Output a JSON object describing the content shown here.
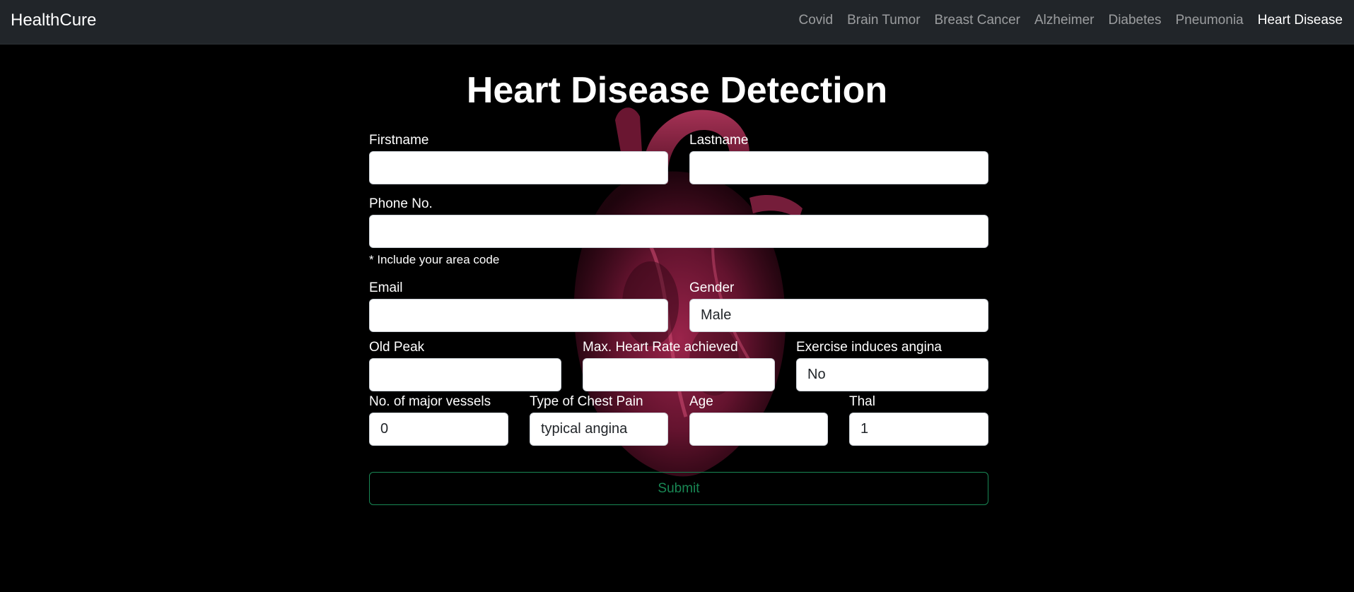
{
  "navbar": {
    "brand": "HealthCure",
    "links": [
      {
        "label": "Covid"
      },
      {
        "label": "Brain Tumor"
      },
      {
        "label": "Breast Cancer"
      },
      {
        "label": "Alzheimer"
      },
      {
        "label": "Diabetes"
      },
      {
        "label": "Pneumonia"
      },
      {
        "label": "Heart Disease",
        "active": true
      }
    ]
  },
  "page": {
    "title": "Heart Disease Detection"
  },
  "form": {
    "firstname": {
      "label": "Firstname",
      "value": ""
    },
    "lastname": {
      "label": "Lastname",
      "value": ""
    },
    "phone": {
      "label": "Phone No.",
      "value": "",
      "help": "* Include your area code"
    },
    "email": {
      "label": "Email",
      "value": ""
    },
    "gender": {
      "label": "Gender",
      "value": "Male"
    },
    "old_peak": {
      "label": "Old Peak",
      "value": ""
    },
    "max_heart_rate": {
      "label": "Max. Heart Rate achieved",
      "value": ""
    },
    "exercise_angina": {
      "label": "Exercise induces angina",
      "value": "No"
    },
    "major_vessels": {
      "label": "No. of major vessels",
      "value": "0"
    },
    "chest_pain": {
      "label": "Type of Chest Pain",
      "value": "typical angina"
    },
    "age": {
      "label": "Age",
      "value": ""
    },
    "thal": {
      "label": "Thal",
      "value": "1"
    },
    "submit_label": "Submit"
  },
  "colors": {
    "navbar_bg": "#212529",
    "page_bg": "#000000",
    "submit_accent": "#198754",
    "heart": "#8b1d3f"
  },
  "background_image": "heart-illustration"
}
